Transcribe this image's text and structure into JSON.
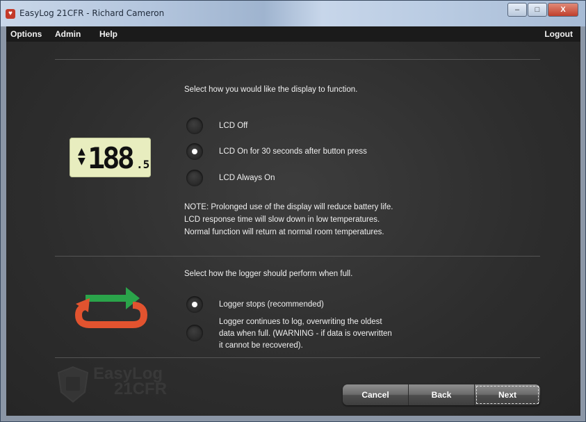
{
  "window": {
    "title": "EasyLog 21CFR - Richard Cameron",
    "minimize": "–",
    "maximize": "□",
    "close": "X"
  },
  "menu": {
    "options": "Options",
    "admin": "Admin",
    "help": "Help",
    "logout": "Logout"
  },
  "display": {
    "prompt": "Select how you would like the display to function.",
    "options": [
      {
        "label": "LCD Off",
        "selected": false
      },
      {
        "label": "LCD On for 30 seconds after button press",
        "selected": true
      },
      {
        "label": "LCD Always On",
        "selected": false
      }
    ],
    "note_lines": [
      "NOTE: Prolonged use of the display will reduce battery life.",
      "LCD response time will slow down in low temperatures.",
      "Normal function will return at normal room temperatures."
    ],
    "lcd": {
      "arrows": "▲\n▼",
      "digits": "188",
      "decimal": ".5"
    }
  },
  "logger": {
    "prompt": "Select how the logger should perform when full.",
    "options": [
      {
        "label_lines": [
          "Logger stops (recommended)"
        ],
        "selected": true
      },
      {
        "label_lines": [
          "Logger continues to log, overwriting the oldest",
          "data when full. (WARNING - if data is overwritten",
          "it cannot be recovered)."
        ],
        "selected": false
      }
    ]
  },
  "logo": {
    "line1": "EasyLog",
    "line2": "21CFR"
  },
  "buttons": {
    "cancel": "Cancel",
    "back": "Back",
    "next": "Next"
  },
  "colors": {
    "arrow_green": "#2aa44a",
    "arrow_red": "#e2532f"
  }
}
